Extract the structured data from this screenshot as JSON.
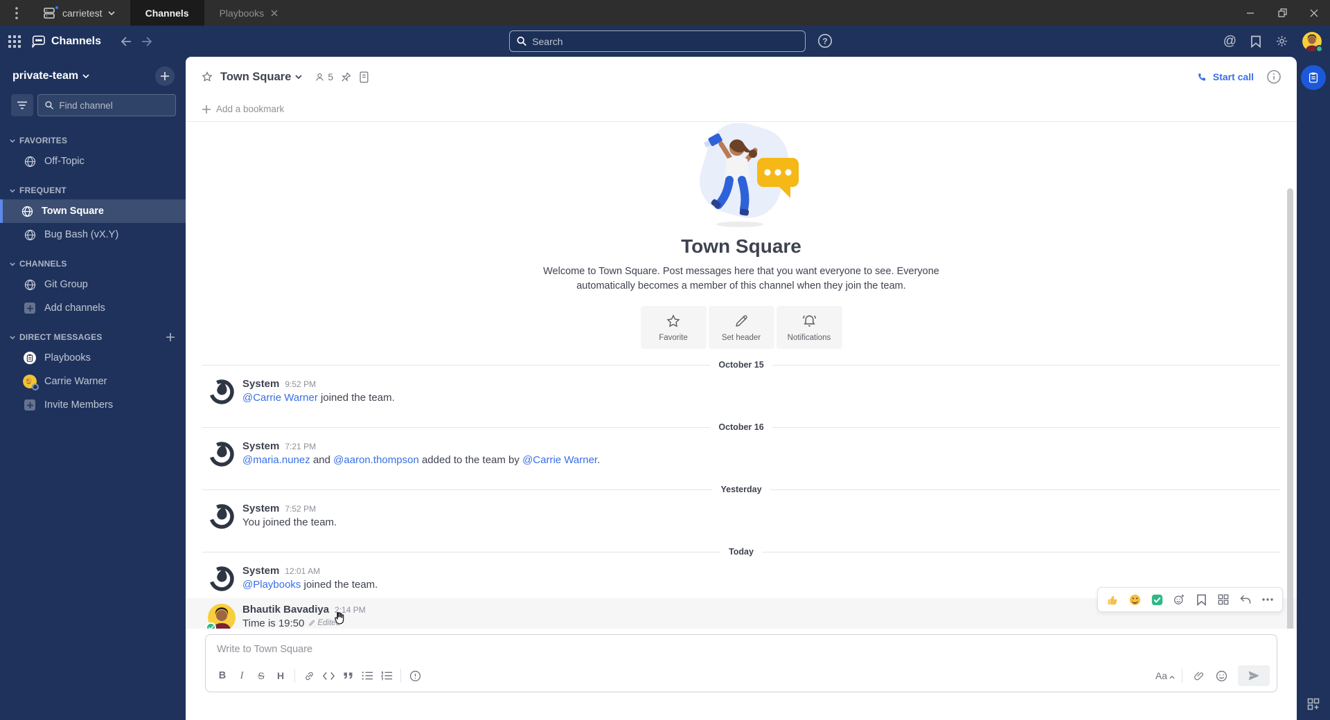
{
  "colors": {
    "navy": "#1e325c",
    "titlebar": "#2e2e2e",
    "accent_blue": "#1c58d9",
    "link_blue": "#386fe5",
    "online_green": "#3db887",
    "active_border": "#5d89ea"
  },
  "titlebar": {
    "server_name": "carrietest",
    "tab_channels": "Channels",
    "tab_playbooks": "Playbooks"
  },
  "global_header": {
    "product_title": "Channels",
    "search_placeholder": "Search"
  },
  "sidebar": {
    "team_name": "private-team",
    "find_placeholder": "Find channel",
    "sections": {
      "favorites": {
        "label": "FAVORITES",
        "item1": "Off-Topic"
      },
      "frequent": {
        "label": "FREQUENT",
        "item1": "Town Square",
        "item2": "Bug Bash (vX.Y)"
      },
      "channels": {
        "label": "CHANNELS",
        "item1": "Git Group",
        "item2": "Add channels"
      },
      "dm": {
        "label": "DIRECT MESSAGES",
        "item1": "Playbooks",
        "item2": "Carrie Warner",
        "item3": "Invite Members"
      }
    }
  },
  "channel_header": {
    "name": "Town Square",
    "member_count": "5",
    "start_call": "Start call"
  },
  "bookmark_bar": {
    "label": "Add a bookmark"
  },
  "intro": {
    "title": "Town Square",
    "welcome_line1": "Welcome to Town Square. Post messages here that you want everyone to see. Everyone",
    "welcome_line2": "automatically becomes a member of this channel when they join the team.",
    "btn_favorite": "Favorite",
    "btn_set_header": "Set header",
    "btn_notifications": "Notifications"
  },
  "feed": {
    "sep1": "October 15",
    "post1": {
      "user": "System",
      "time": "9:52 PM",
      "m1": "@Carrie Warner",
      "t1": " joined the team."
    },
    "sep2": "October 16",
    "post2": {
      "user": "System",
      "time": "7:21 PM",
      "m1": "@maria.nunez",
      "t1": " and ",
      "m2": "@aaron.thompson",
      "t2": " added to the team by ",
      "m3": "@Carrie Warner",
      "t3": "."
    },
    "sep3": "Yesterday",
    "post3": {
      "user": "System",
      "time": "7:52 PM",
      "t1": "You joined the team."
    },
    "sep4": "Today",
    "post4": {
      "user": "System",
      "time": "12:01 AM",
      "m1": "@Playbooks",
      "t1": " joined the team."
    },
    "post5": {
      "user": "Bhautik Bavadiya",
      "time": "2:14 PM",
      "t1": "Time is 19:50",
      "edited": "Edited"
    }
  },
  "composer": {
    "placeholder": "Write to Town Square",
    "format_toggle": "Aa"
  }
}
